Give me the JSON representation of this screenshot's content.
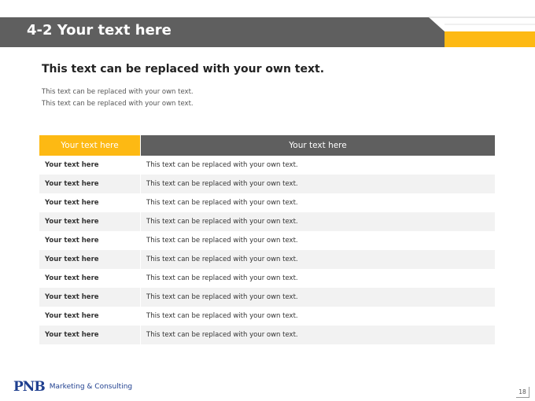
{
  "header": {
    "title": "4-2 Your text here"
  },
  "content": {
    "subtitle": "This text can be replaced with your own text.",
    "lines": [
      "This text can be replaced with your own text.",
      "This text can be replaced with your own text."
    ]
  },
  "table": {
    "headers": [
      "Your text here",
      "Your text here"
    ],
    "rows": [
      [
        "Your text here",
        "This text can be replaced with your own text."
      ],
      [
        "Your text here",
        "This text can be replaced with your own text."
      ],
      [
        "Your text here",
        "This text can be replaced with your own text."
      ],
      [
        "Your text here",
        "This text can be replaced with your own text."
      ],
      [
        "Your text here",
        "This text can be replaced with your own text."
      ],
      [
        "Your text here",
        "This text can be replaced with your own text."
      ],
      [
        "Your text here",
        "This text can be replaced with your own text."
      ],
      [
        "Your text here",
        "This text can be replaced with your own text."
      ],
      [
        "Your text here",
        "This text can be replaced with your own text."
      ],
      [
        "Your text here",
        "This text can be replaced with your own text."
      ]
    ]
  },
  "footer": {
    "logo_mark": "PNB",
    "logo_text": "Marketing & Consulting",
    "page_number": "18"
  },
  "colors": {
    "accent": "#fdb913",
    "header_gray": "#5f5f5f",
    "row_alt": "#f2f2f2",
    "brand_blue": "#1f3f8f"
  }
}
